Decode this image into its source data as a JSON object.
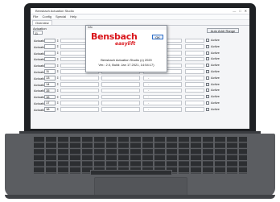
{
  "app": {
    "title": "Bensbach Actuation Studio",
    "menu": [
      "File",
      "Config",
      "Special",
      "Help"
    ],
    "window_controls": [
      "—",
      "□",
      "✕"
    ],
    "tabs": [
      "Overview"
    ],
    "toolbar": {
      "label": "Actuation",
      "stepper_value": "11",
      "add_range_label": "Auto Addr Range"
    },
    "rows": [
      {
        "label": "Actuation",
        "value": "",
        "dash": "-",
        "checkbox": "Active"
      },
      {
        "label": "Actuation",
        "value": "",
        "dash": "-",
        "checkbox": "Active"
      },
      {
        "label": "Actuation",
        "value": "",
        "dash": "-",
        "checkbox": "Active"
      },
      {
        "label": "Actuation",
        "value": "",
        "dash": "-",
        "checkbox": "Active"
      },
      {
        "label": "Actuation",
        "value": "",
        "dash": "-",
        "checkbox": "Active"
      },
      {
        "label": "Actuation",
        "value": "11",
        "dash": "-",
        "checkbox": "Active"
      },
      {
        "label": "Actuation",
        "value": "13",
        "dash": "-",
        "checkbox": "Active"
      },
      {
        "label": "Actuation",
        "value": "14",
        "dash": "-",
        "checkbox": "Active"
      },
      {
        "label": "Actuation",
        "value": "15",
        "dash": "-",
        "checkbox": "Active"
      },
      {
        "label": "Actuation",
        "value": "16",
        "dash": "-",
        "checkbox": "Active"
      },
      {
        "label": "Actuation",
        "value": "17",
        "dash": "-",
        "checkbox": "Active"
      },
      {
        "label": "Actuation",
        "value": "18",
        "dash": "-",
        "checkbox": "Active"
      }
    ]
  },
  "dialog": {
    "title": "Info",
    "ok_label": "OK",
    "logo_main": "Bensbach",
    "logo_sub": "easylift",
    "info_line1": "Bensbach Actuation Studio (c) 2020",
    "info_line2": "Ver.: 2.0, Build: Jan 17 2021, 14:54:17)"
  },
  "colors": {
    "brand_red": "#d9151b",
    "laptop_body": "#5b5d61",
    "bezel": "#1f2124"
  }
}
